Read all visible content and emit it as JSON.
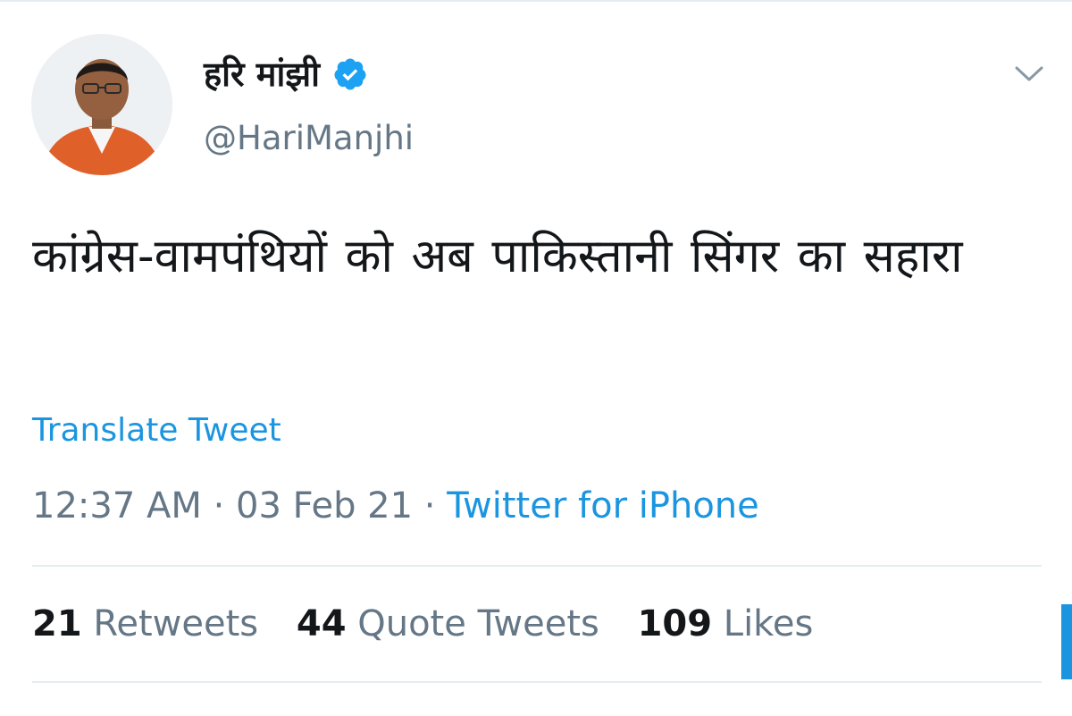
{
  "author": {
    "display_name": "हरि मांझी",
    "handle": "@HariManjhi",
    "avatar_icon": "profile-photo",
    "verified_icon": "verified-badge-icon"
  },
  "tweet": {
    "text": "कांग्रेस-वामपंथियों  को अब पाकिस्तानी सिंगर का सहारा",
    "translate_label": "Translate Tweet"
  },
  "meta": {
    "time": "12:37 AM",
    "separator": "·",
    "date": "03 Feb 21",
    "source": "Twitter for iPhone"
  },
  "stats": {
    "retweets_count": "21",
    "retweets_label": "Retweets",
    "quotes_count": "44",
    "quotes_label": "Quote Tweets",
    "likes_count": "109",
    "likes_label": "Likes"
  },
  "colors": {
    "accent": "#1b95e0",
    "text_primary": "#14171a",
    "text_secondary": "#657786",
    "divider": "#e6ecf0"
  }
}
